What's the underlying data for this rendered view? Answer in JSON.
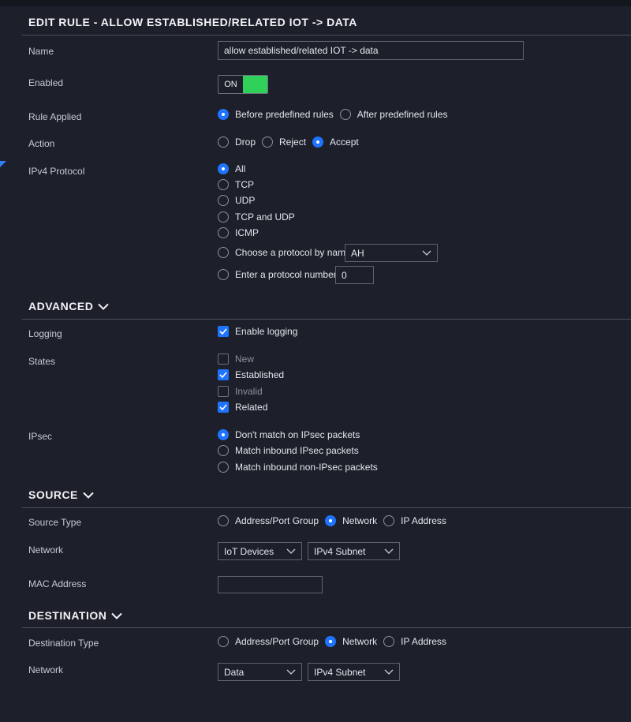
{
  "title": "EDIT RULE - ALLOW ESTABLISHED/RELATED IOT -> DATA",
  "colors": {
    "accent": "#1f74ff",
    "toggle_on": "#2fd15a",
    "background": "#1d202b"
  },
  "name": {
    "label": "Name",
    "value": "allow  established/related IOT -> data"
  },
  "enabled": {
    "label": "Enabled",
    "state": "ON"
  },
  "rule_applied": {
    "label": "Rule Applied",
    "options": [
      "Before predefined rules",
      "After predefined rules"
    ],
    "selected": "Before predefined rules"
  },
  "action": {
    "label": "Action",
    "options": [
      "Drop",
      "Reject",
      "Accept"
    ],
    "selected": "Accept"
  },
  "ipv4_protocol": {
    "label": "IPv4 Protocol",
    "options": [
      "All",
      "TCP",
      "UDP",
      "TCP and UDP",
      "ICMP",
      "Choose a protocol by name",
      "Enter a protocol number"
    ],
    "selected": "All",
    "protocol_name_value": "AH",
    "protocol_number_value": "0"
  },
  "advanced": {
    "title": "ADVANCED",
    "logging": {
      "label": "Logging",
      "option": "Enable logging",
      "checked": true
    },
    "states": {
      "label": "States",
      "items": [
        {
          "label": "New",
          "checked": false
        },
        {
          "label": "Established",
          "checked": true
        },
        {
          "label": "Invalid",
          "checked": false
        },
        {
          "label": "Related",
          "checked": true
        }
      ]
    },
    "ipsec": {
      "label": "IPsec",
      "options": [
        "Don't match on IPsec packets",
        "Match inbound IPsec packets",
        "Match inbound non-IPsec packets"
      ],
      "selected": "Don't match on IPsec packets"
    }
  },
  "source": {
    "title": "SOURCE",
    "type": {
      "label": "Source Type",
      "options": [
        "Address/Port Group",
        "Network",
        "IP Address"
      ],
      "selected": "Network"
    },
    "network": {
      "label": "Network",
      "value": "IoT Devices",
      "subnet": "IPv4 Subnet"
    },
    "mac": {
      "label": "MAC Address",
      "value": ""
    }
  },
  "destination": {
    "title": "DESTINATION",
    "type": {
      "label": "Destination Type",
      "options": [
        "Address/Port Group",
        "Network",
        "IP Address"
      ],
      "selected": "Network"
    },
    "network": {
      "label": "Network",
      "value": "Data",
      "subnet": "IPv4 Subnet"
    }
  }
}
